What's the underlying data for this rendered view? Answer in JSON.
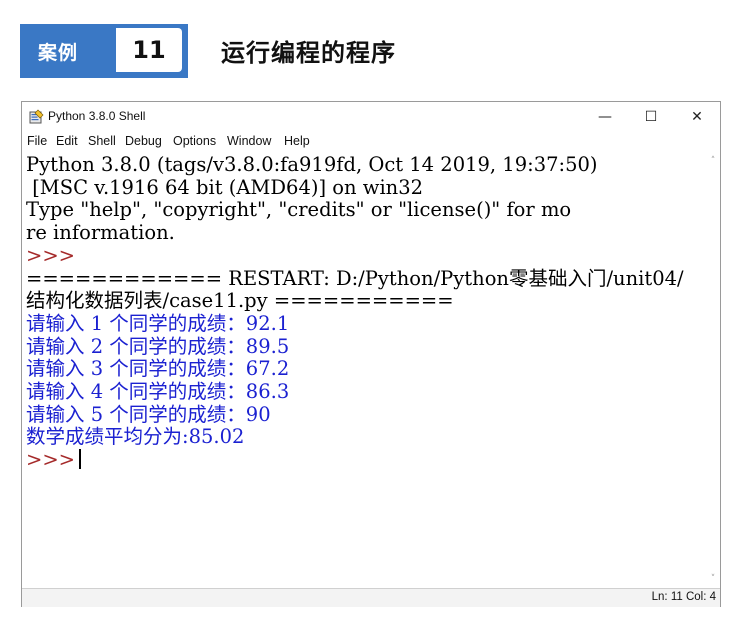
{
  "header": {
    "case_label": "案例",
    "case_number": "11",
    "title": "运行编程的程序"
  },
  "window": {
    "title": "Python 3.8.0 Shell",
    "controls": {
      "minimize": "—",
      "maximize": "☐",
      "close": "✕"
    },
    "menu": [
      "File",
      "Edit",
      "Shell",
      "Debug",
      "Options",
      "Window",
      "Help"
    ],
    "shell": {
      "banner1": "Python 3.8.0 (tags/v3.8.0:fa919fd, Oct 14 2019, 19:37:50)",
      "banner2": " [MSC v.1916 64 bit (AMD64)] on win32",
      "banner3": "Type \"help\", \"copyright\", \"credits\" or \"license()\" for mo",
      "banner4": "re information.",
      "prompt": ">>>",
      "restart1": "============ RESTART: D:/Python/Python零基础入门/unit04/",
      "restart2": "结构化数据列表/case11.py ===========",
      "outputs": [
        "请输入 1 个同学的成绩：92.1",
        "请输入 2 个同学的成绩：89.5",
        "请输入 3 个同学的成绩：67.2",
        "请输入 4 个同学的成绩：86.3",
        "请输入 5 个同学的成绩：90",
        "数学成绩平均分为:85.02"
      ]
    },
    "status": "Ln: 11  Col: 4"
  },
  "colors": {
    "accent": "#3a78c5",
    "output_blue": "#1b21d1",
    "prompt_red": "#a52a2a"
  },
  "icons": {
    "window_icon": "python-shell-icon"
  }
}
